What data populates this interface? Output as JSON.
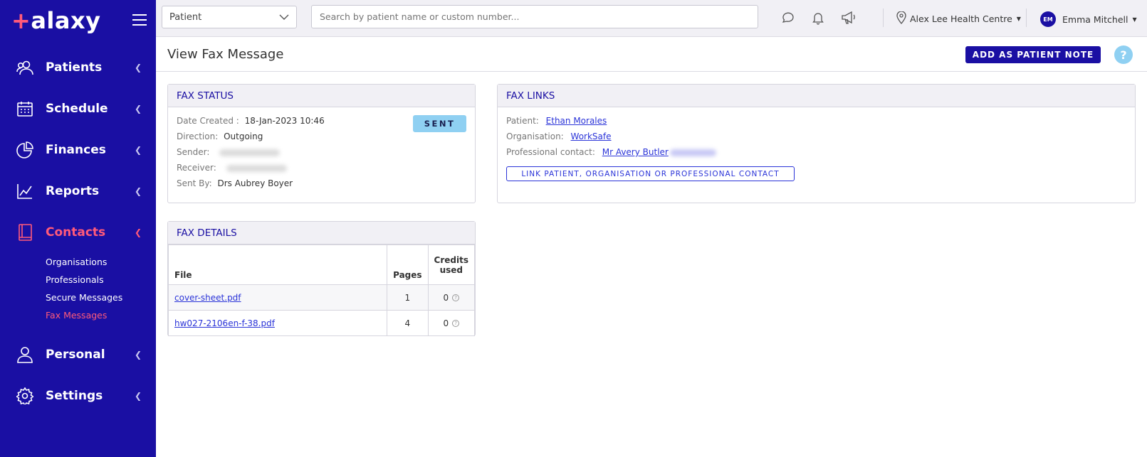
{
  "app": {
    "logo": "Halaxy"
  },
  "sidebar": {
    "items": [
      {
        "label": "Patients",
        "icon": "patients-icon"
      },
      {
        "label": "Schedule",
        "icon": "calendar-icon"
      },
      {
        "label": "Finances",
        "icon": "pie-chart-icon"
      },
      {
        "label": "Reports",
        "icon": "line-chart-icon"
      },
      {
        "label": "Contacts",
        "icon": "address-book-icon"
      },
      {
        "label": "Personal",
        "icon": "person-icon"
      },
      {
        "label": "Settings",
        "icon": "gear-icon"
      }
    ],
    "contacts_subitems": [
      "Organisations",
      "Professionals",
      "Secure Messages",
      "Fax Messages"
    ],
    "active_item": "Contacts",
    "active_subitem": "Fax Messages"
  },
  "topbar": {
    "search_type": "Patient",
    "search_placeholder": "Search by patient name or custom number...",
    "location": "Alex Lee Health Centre",
    "user_initials": "EM",
    "user_name": "Emma Mitchell"
  },
  "page": {
    "title": "View Fax Message",
    "add_note_label": "ADD AS PATIENT NOTE",
    "help_label": "?"
  },
  "fax_status": {
    "heading": "FAX STATUS",
    "date_created_label": "Date Created :",
    "date_created": "18-Jan-2023 10:46",
    "direction_label": "Direction:",
    "direction": "Outgoing",
    "sender_label": "Sender:",
    "receiver_label": "Receiver:",
    "sent_by_label": "Sent By:",
    "sent_by": "Drs Aubrey Boyer",
    "status": "SENT"
  },
  "fax_links": {
    "heading": "FAX LINKS",
    "patient_label": "Patient:",
    "patient": "Ethan Morales",
    "organisation_label": "Organisation:",
    "organisation": "WorkSafe",
    "professional_label": "Professional contact:",
    "professional": "Mr Avery Butler",
    "link_button": "LINK PATIENT, ORGANISATION OR PROFESSIONAL CONTACT"
  },
  "fax_details": {
    "heading": "FAX DETAILS",
    "columns": [
      "File",
      "Pages",
      "Credits used"
    ],
    "rows": [
      {
        "file": "cover-sheet.pdf",
        "pages": "1",
        "credits": "0"
      },
      {
        "file": "hw027-2106en-f-38.pdf",
        "pages": "4",
        "credits": "0"
      }
    ]
  },
  "colors": {
    "sidebar": "#1a0fa3",
    "accent": "#ff5a7a",
    "badge": "#8fd0f2",
    "link": "#2a33d8"
  }
}
